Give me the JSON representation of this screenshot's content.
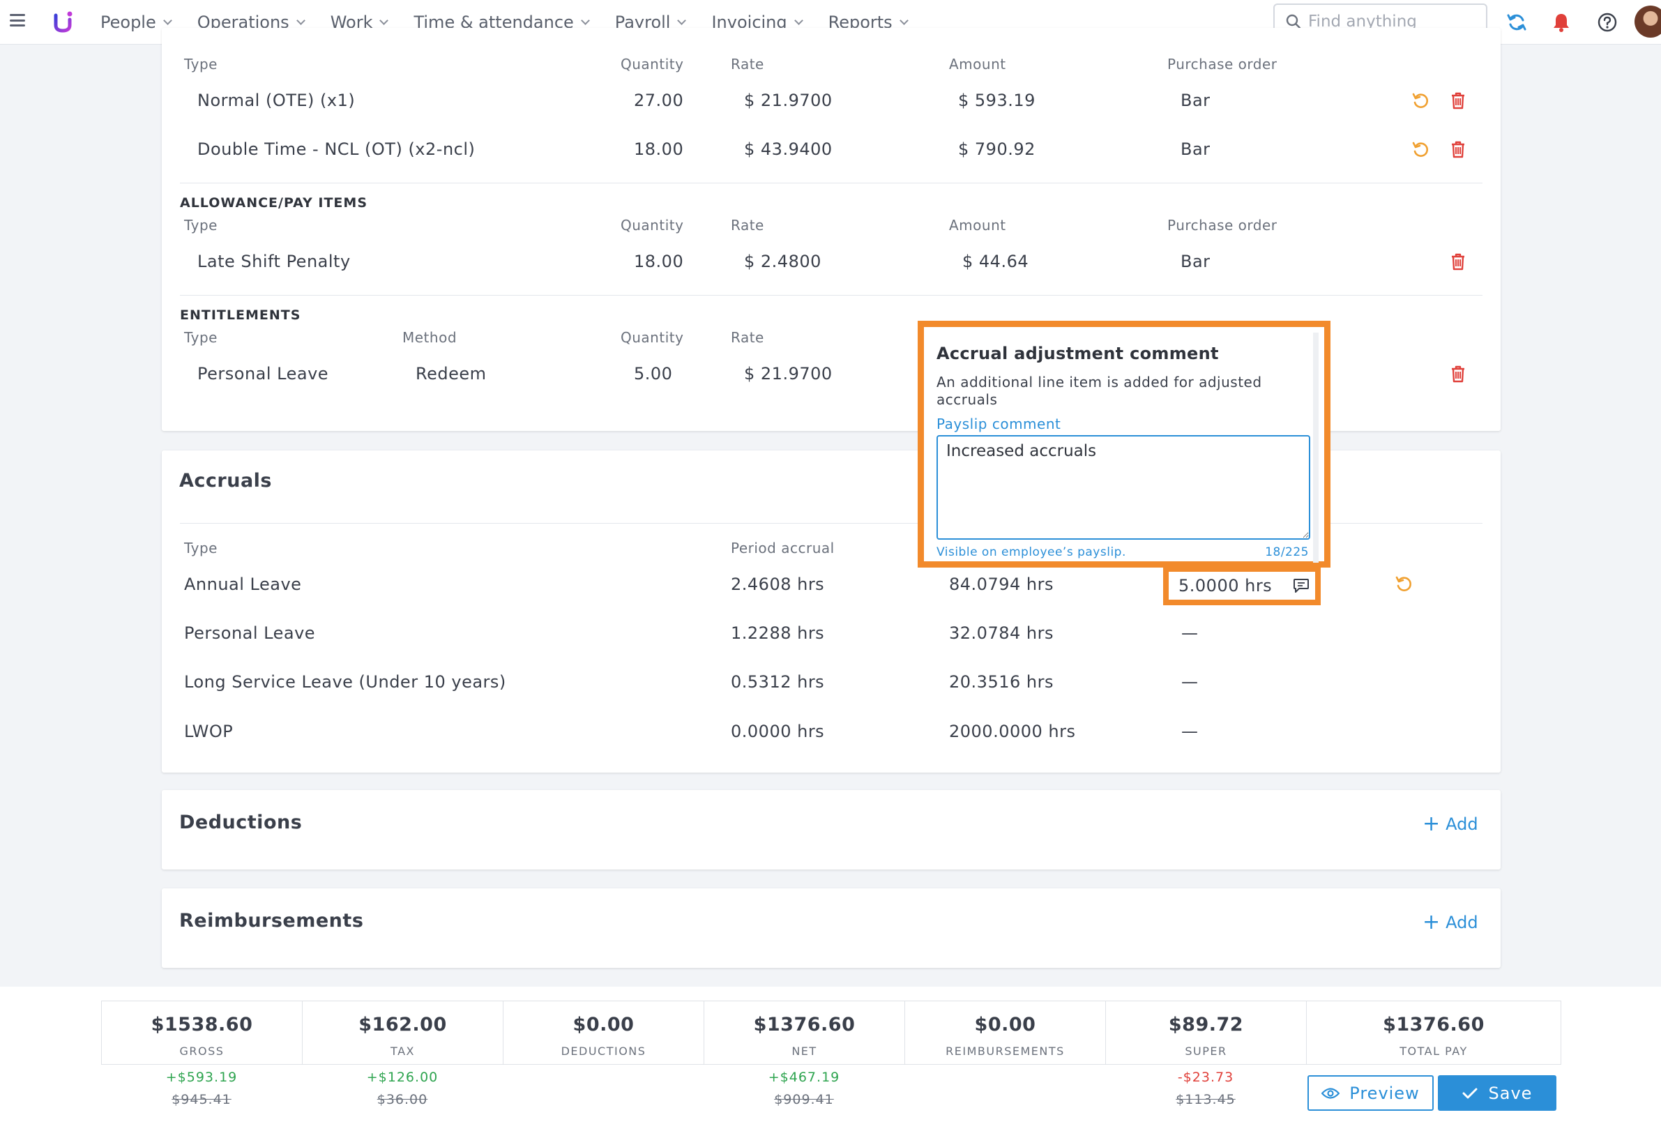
{
  "nav": {
    "items": [
      {
        "label": "People"
      },
      {
        "label": "Operations"
      },
      {
        "label": "Work"
      },
      {
        "label": "Time & attendance"
      },
      {
        "label": "Payroll"
      },
      {
        "label": "Invoicing"
      },
      {
        "label": "Reports"
      }
    ],
    "search_placeholder": "Find anything",
    "icons": [
      "menu-icon",
      "refresh-icon",
      "bell-icon",
      "help-icon"
    ]
  },
  "pay_rates": {
    "headers": {
      "type": "Type",
      "quantity": "Quantity",
      "rate": "Rate",
      "amount": "Amount",
      "po": "Purchase order"
    },
    "rows": [
      {
        "type": "Normal (OTE) (x1)",
        "quantity": "27.00",
        "rate": "$ 21.9700",
        "amount": "$ 593.19",
        "po": "Bar"
      },
      {
        "type": "Double Time - NCL (OT) (x2-ncl)",
        "quantity": "18.00",
        "rate": "$ 43.9400",
        "amount": "$ 790.92",
        "po": "Bar"
      }
    ]
  },
  "allowances": {
    "title": "ALLOWANCE/PAY ITEMS",
    "headers": {
      "type": "Type",
      "quantity": "Quantity",
      "rate": "Rate",
      "amount": "Amount",
      "po": "Purchase order"
    },
    "rows": [
      {
        "type": "Late Shift Penalty",
        "quantity": "18.00",
        "rate": "$ 2.4800",
        "amount": "$ 44.64",
        "po": "Bar"
      }
    ]
  },
  "entitlements": {
    "title": "ENTITLEMENTS",
    "headers": {
      "type": "Type",
      "method": "Method",
      "quantity": "Quantity",
      "rate": "Rate"
    },
    "rows": [
      {
        "type": "Personal Leave",
        "method": "Redeem",
        "quantity": "5.00",
        "rate": "$ 21.9700"
      }
    ]
  },
  "accruals": {
    "title": "Accruals",
    "headers": {
      "type": "Type",
      "period": "Period accrual"
    },
    "rows": [
      {
        "type": "Annual Leave",
        "period": "2.4608 hrs",
        "balance": "84.0794 hrs",
        "adjustment": "5.0000 hrs"
      },
      {
        "type": "Personal Leave",
        "period": "1.2288 hrs",
        "balance": "32.0784 hrs",
        "adjustment": "—"
      },
      {
        "type": "Long Service Leave (Under 10 years)",
        "period": "0.5312 hrs",
        "balance": "20.3516 hrs",
        "adjustment": "—"
      },
      {
        "type": "LWOP",
        "period": "0.0000 hrs",
        "balance": "2000.0000 hrs",
        "adjustment": "—"
      }
    ]
  },
  "popup": {
    "title": "Accrual adjustment comment",
    "description": "An additional line item is added for adjusted accruals",
    "label": "Payslip comment",
    "value": "Increased accruals",
    "hint": "Visible on employee’s payslip.",
    "count": "18/225"
  },
  "deductions": {
    "title": "Deductions",
    "add_label": "Add"
  },
  "reimbursements": {
    "title": "Reimbursements",
    "add_label": "Add"
  },
  "summary": [
    {
      "value": "$1538.60",
      "label": "GROSS",
      "diff": "+$593.19",
      "diff_type": "pos",
      "old": "$945.41"
    },
    {
      "value": "$162.00",
      "label": "TAX",
      "diff": "+$126.00",
      "diff_type": "pos",
      "old": "$36.00"
    },
    {
      "value": "$0.00",
      "label": "DEDUCTIONS",
      "diff": "",
      "diff_type": "",
      "old": ""
    },
    {
      "value": "$1376.60",
      "label": "NET",
      "diff": "+$467.19",
      "diff_type": "pos",
      "old": "$909.41"
    },
    {
      "value": "$0.00",
      "label": "REIMBURSEMENTS",
      "diff": "",
      "diff_type": "",
      "old": ""
    },
    {
      "value": "$89.72",
      "label": "SUPER",
      "diff": "-$23.73",
      "diff_type": "neg",
      "old": "$113.45"
    },
    {
      "value": "$1376.60",
      "label": "TOTAL PAY",
      "diff": "",
      "diff_type": "",
      "old": ""
    }
  ],
  "actions": {
    "preview": "Preview",
    "save": "Save"
  },
  "colors": {
    "accent": "#2b8fd8",
    "highlight": "#f28a2b",
    "positive": "#2ea44f",
    "negative": "#e0403a",
    "delete": "#e0403a",
    "undo": "#f0a030"
  }
}
